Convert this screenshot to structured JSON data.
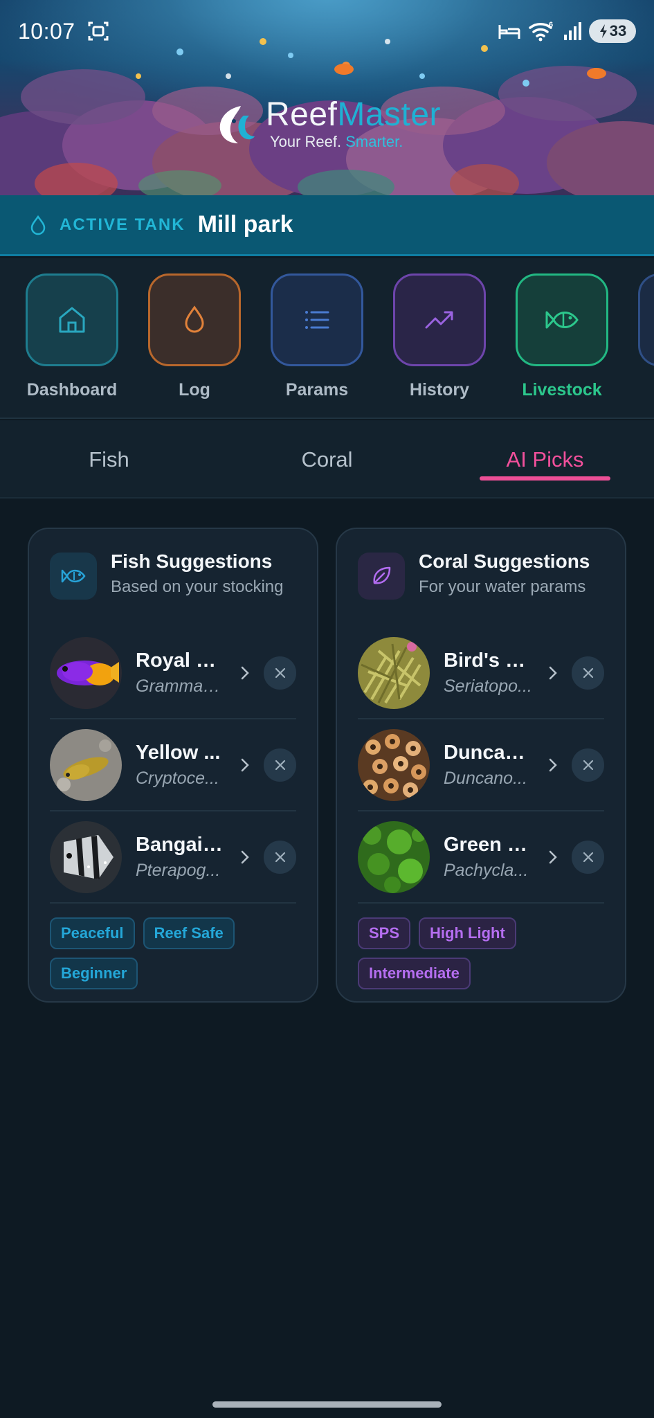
{
  "status_bar": {
    "time": "10:07",
    "battery": "33",
    "signal_label": "6"
  },
  "brand": {
    "name_part1": "Reef",
    "name_part2": "Master",
    "tagline_part1": "Your Reef.",
    "tagline_part2": "Smarter."
  },
  "active_tank": {
    "label": "ACTIVE TANK",
    "name": "Mill park"
  },
  "nav": {
    "items": [
      {
        "label": "Dashboard",
        "icon": "home-icon",
        "color": "#1e8fa3"
      },
      {
        "label": "Log",
        "icon": "drop-icon",
        "color": "#d9762f"
      },
      {
        "label": "Params",
        "icon": "list-icon",
        "color": "#3d67b5"
      },
      {
        "label": "History",
        "icon": "trend-up-icon",
        "color": "#8a4fd1"
      },
      {
        "label": "Livestock",
        "icon": "fish-icon",
        "color": "#22c08a",
        "active": true
      }
    ]
  },
  "tabs": [
    {
      "label": "Fish"
    },
    {
      "label": "Coral"
    },
    {
      "label": "AI Picks",
      "active": true
    }
  ],
  "fish_card": {
    "title": "Fish Suggestions",
    "subtitle": "Based on your stocking",
    "items": [
      {
        "name": "Royal G...",
        "scientific": "Gramma l..."
      },
      {
        "name": "Yellow ...",
        "scientific": "Cryptoce..."
      },
      {
        "name": "Bangaii...",
        "scientific": "Pterapog..."
      }
    ],
    "tags": [
      "Peaceful",
      "Reef Safe",
      "Beginner"
    ]
  },
  "coral_card": {
    "title": "Coral Suggestions",
    "subtitle": "For your water params",
    "items": [
      {
        "name": "Bird's N...",
        "scientific": "Seriatopo..."
      },
      {
        "name": "Duncan...",
        "scientific": "Duncano..."
      },
      {
        "name": "Green S...",
        "scientific": "Pachycla..."
      }
    ],
    "tags": [
      "SPS",
      "High Light",
      "Intermediate"
    ]
  }
}
